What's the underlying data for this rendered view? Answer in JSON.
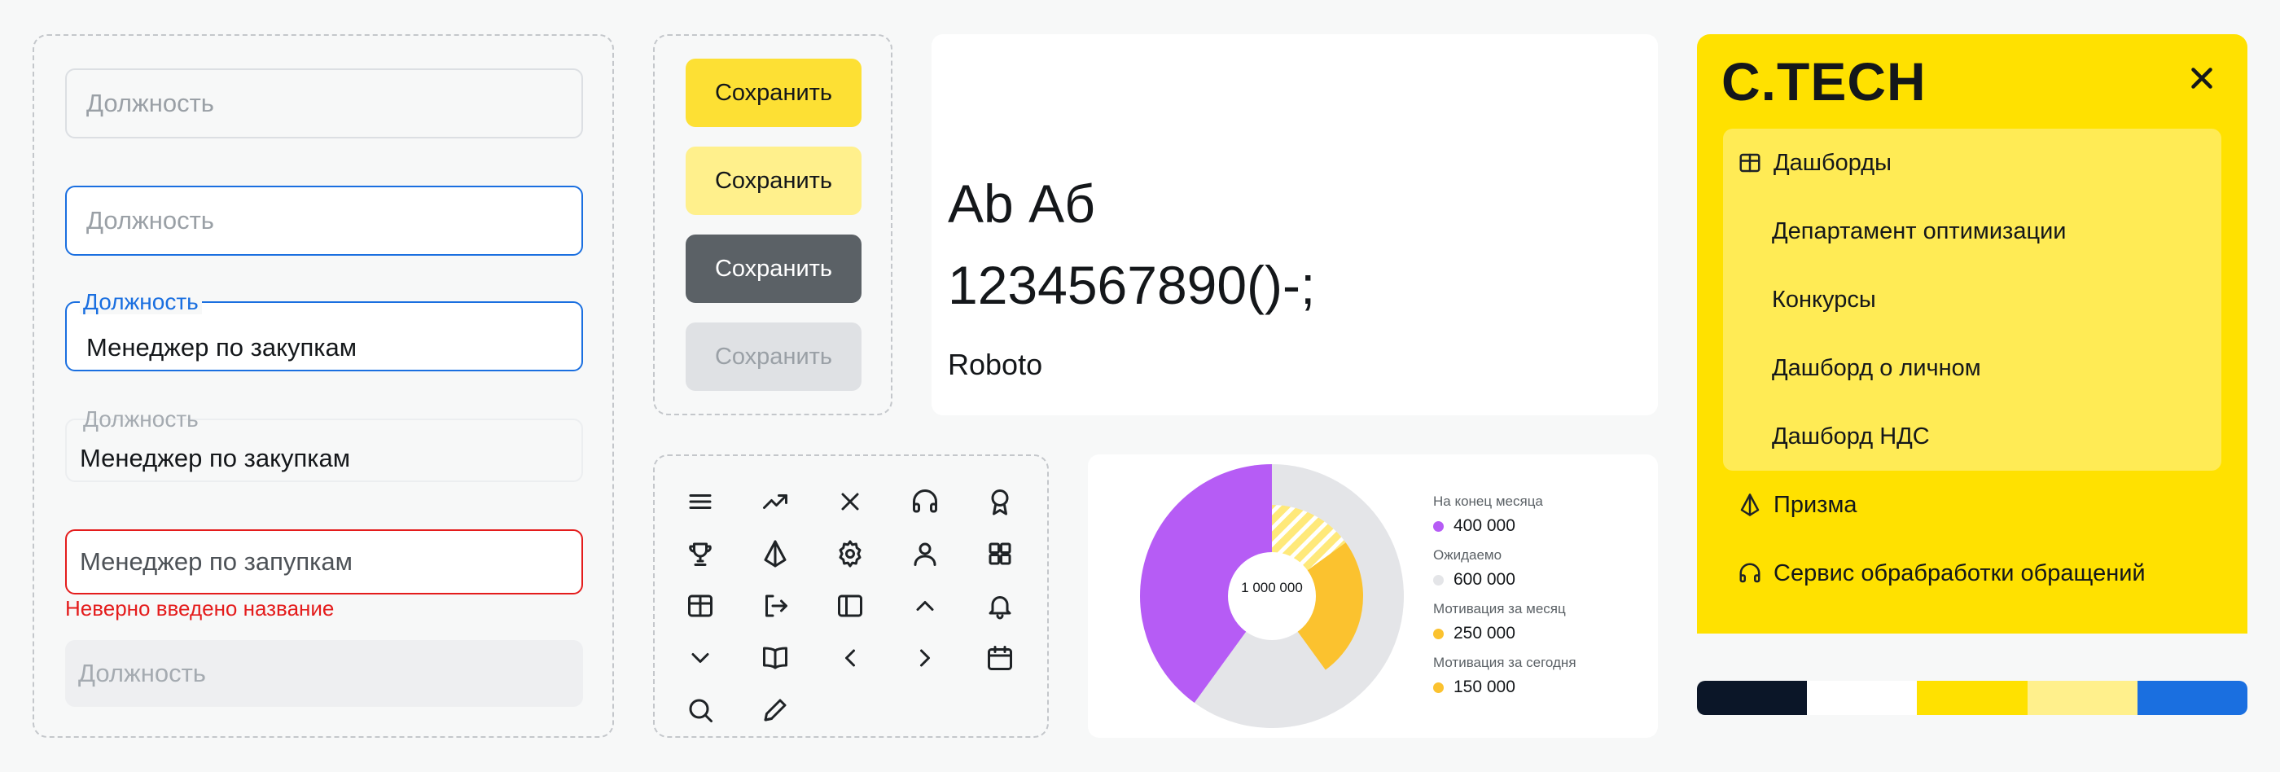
{
  "inputs": {
    "field_default": {
      "placeholder": "Должность"
    },
    "field_focused": {
      "placeholder": "Должность"
    },
    "field_filled_focus": {
      "label": "Должность",
      "value": "Менеджер по закупкам"
    },
    "field_filled": {
      "label": "Должность",
      "value": "Менеджер по закупкам"
    },
    "field_error": {
      "value": "Менеджер по запупкам",
      "error": "Неверно введено название"
    },
    "field_disabled": {
      "placeholder": "Должность"
    }
  },
  "buttons": {
    "primary": "Сохранить",
    "secondary": "Сохранить",
    "dark": "Сохранить",
    "disabled": "Сохранить"
  },
  "typography": {
    "sample_letters": "Ab Аб",
    "sample_digits": "1234567890()-;",
    "font_name": "Roboto"
  },
  "icons": [
    "menu-icon",
    "trending-up-icon",
    "close-icon",
    "headphones-icon",
    "award-icon",
    "trophy-icon",
    "prism-icon",
    "gear-icon",
    "user-icon",
    "grid-icon",
    "table-icon",
    "logout-icon",
    "sidebar-icon",
    "chevron-up-icon",
    "bell-icon",
    "chevron-down-icon",
    "book-icon",
    "chevron-left-icon",
    "chevron-right-icon",
    "calendar-icon",
    "search-icon",
    "pencil-icon"
  ],
  "chart_data": {
    "type": "pie",
    "center_label": "1 000 000",
    "series": [
      {
        "name": "На конец месяца",
        "value_label": "400 000",
        "value": 400000,
        "color": "#b65cf5"
      },
      {
        "name": "Ожидаемо",
        "value_label": "600 000",
        "value": 600000,
        "color": "#e4e5e8"
      },
      {
        "name": "Мотивация за месяц",
        "value_label": "250 000",
        "value": 250000,
        "color": "#fbc22f"
      },
      {
        "name": "Мотивация за сегодня",
        "value_label": "150 000",
        "value": 150000,
        "color": "#fbc22f"
      }
    ],
    "legend": "right"
  },
  "sidebar": {
    "logo": "C.TECH",
    "group": {
      "title": "Дашборды",
      "icon": "table-icon",
      "items": [
        "Департамент оптимизации",
        "Конкурсы",
        "Дашборд о личном",
        "Дашборд НДС"
      ]
    },
    "items": [
      {
        "label": "Призма",
        "icon": "prism-icon"
      },
      {
        "label": "Сервис обрабработки обращений",
        "icon": "headphones-icon"
      }
    ]
  },
  "palette": [
    "#0b1628",
    "#ffffff",
    "#ffe100",
    "#fff08c",
    "#1a6fe0"
  ]
}
